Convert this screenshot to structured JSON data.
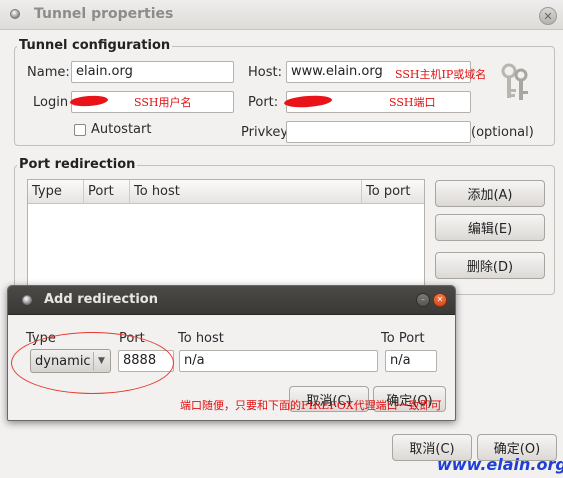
{
  "window": {
    "title": "Tunnel properties"
  },
  "tunnel_config": {
    "heading": "Tunnel configuration",
    "name_label": "Name:",
    "name_value": "elain.org",
    "host_label": "Host:",
    "host_value": "www.elain.org",
    "login_label": "Login",
    "login_value": "",
    "port_label": "Port:",
    "port_value": "",
    "autostart_label": "Autostart",
    "privkey_label": "Privkey",
    "privkey_value": "",
    "optional_label": "(optional)"
  },
  "annotations": {
    "host_note": "SSH主机IP或域名",
    "login_note": "SSH用户名",
    "port_note": "SSH端口",
    "dialog_note": "端口随便，只要和下面的FIREFOX代理端口一致即可"
  },
  "port_redirection": {
    "heading": "Port redirection",
    "columns": [
      "Type",
      "Port",
      "To host",
      "To port"
    ],
    "rows": [],
    "add_button": "添加(A)",
    "edit_button": "编辑(E)",
    "delete_button": "删除(D)"
  },
  "add_redirection": {
    "title": "Add redirection",
    "type_label": "Type",
    "port_label": "Port",
    "to_host_label": "To host",
    "to_port_label": "To Port",
    "type_value": "dynamic",
    "port_value": "8888",
    "to_host_value": "n/a",
    "to_port_value": "n/a",
    "cancel_button": "取消(C)",
    "ok_button": "确定(O)"
  },
  "footer": {
    "cancel_button": "取消(C)",
    "ok_button": "确定(O)"
  },
  "watermark": "www.elain.org",
  "colors": {
    "annotation_red": "#e01010",
    "watermark_blue": "#1f3fd6",
    "dialog_titlebar": "#3f3e3a"
  }
}
